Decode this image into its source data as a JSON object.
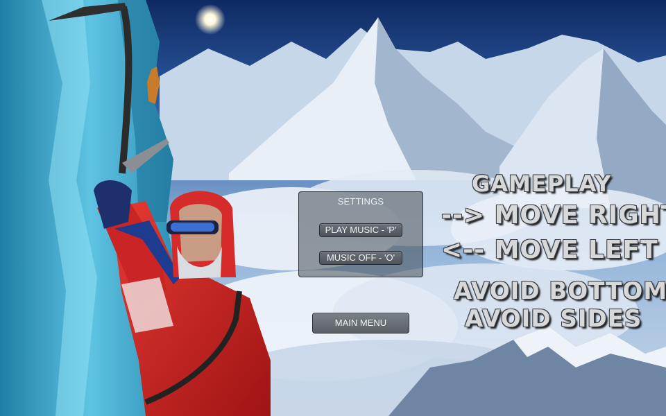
{
  "settings": {
    "title": "SETTINGS",
    "play_music_label": "PLAY MUSIC - 'P'",
    "music_off_label": "MUSIC OFF - 'O'"
  },
  "main_menu_label": "MAIN MENU",
  "gameplay": {
    "heading": "GAMEPLAY",
    "move_right": "--> MOVE RIGHT",
    "move_left": "<-- MOVE LEFT",
    "avoid_bottom": "AVOID BOTTOM",
    "avoid_sides": "AVOID SIDES"
  },
  "colors": {
    "sky": "#1b3f7a",
    "ice": "#3fa6c9",
    "jacket": "#d62a2a",
    "panel": "#464e56",
    "button": "#5a6066",
    "text_metal": "#d6d8da"
  }
}
